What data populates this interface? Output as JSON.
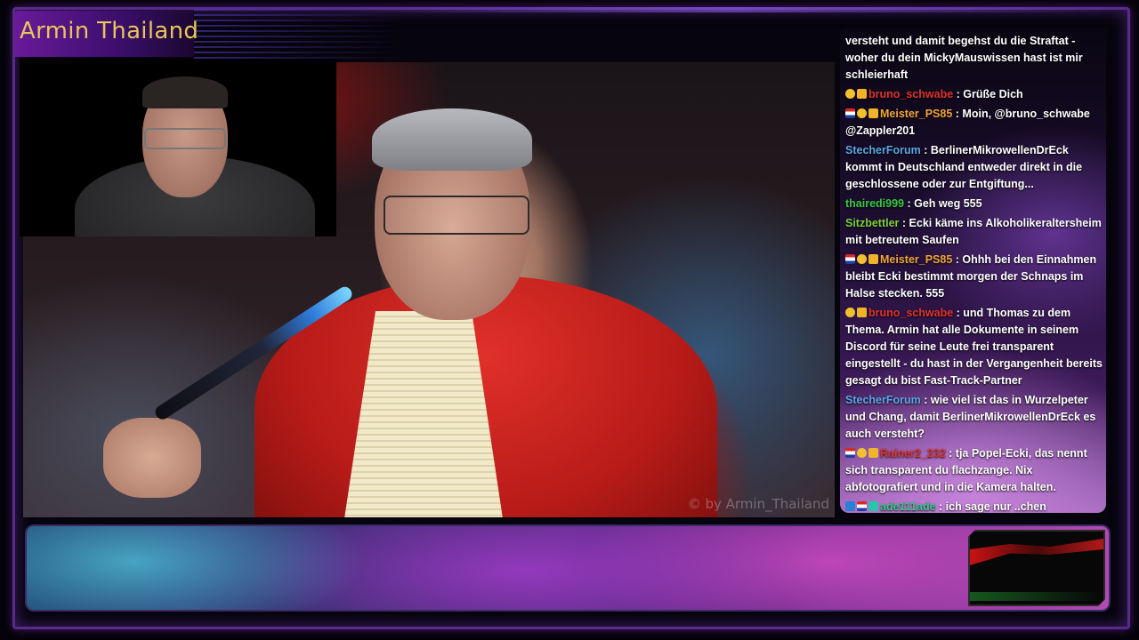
{
  "stream": {
    "channel_title": "Armin Thailand",
    "watermark": "© by Armin_Thailand"
  },
  "chat": {
    "messages": [
      {
        "user": "",
        "color": "#ffffff",
        "badges": [],
        "text": "versteht und damit begehst du die Straftat - woher du dein MickyMauswissen hast ist mir schleierhaft"
      },
      {
        "user": "bruno_schwabe",
        "color": "#e0332c",
        "badges": [
          "coin",
          "crown"
        ],
        "text": "Grüße Dich"
      },
      {
        "user": "Meister_PS85",
        "color": "#f0a43a",
        "badges": [
          "flag",
          "coin",
          "crown"
        ],
        "text": "Moin, @bruno_schwabe @Zappler201"
      },
      {
        "user": "StecherForum",
        "color": "#5aa7e6",
        "badges": [],
        "text": "BerlinerMikrowellenDrEck kommt in Deutschland entweder direkt in die geschlossene oder zur Entgiftung..."
      },
      {
        "user": "thairedi999",
        "color": "#37c944",
        "badges": [],
        "text": "Geh weg 555"
      },
      {
        "user": "Sitzbettler",
        "color": "#7bd23a",
        "badges": [],
        "text": "Ecki käme ins Alkoholikeraltersheim mit betreutem Saufen"
      },
      {
        "user": "Meister_PS85",
        "color": "#f0a43a",
        "badges": [
          "flag",
          "coin",
          "crown"
        ],
        "text": "Ohhh bei den Einnahmen bleibt Ecki bestimmt morgen der Schnaps im Halse stecken. 555"
      },
      {
        "user": "bruno_schwabe",
        "color": "#e0332c",
        "badges": [
          "coin",
          "crown"
        ],
        "text": "und Thomas zu dem Thema. Armin hat alle Dokumente in seinem Discord für seine Leute frei transparent eingestellt - du hast in der Vergangenheit bereits gesagt du bist Fast-Track-Partner"
      },
      {
        "user": "StecherForum",
        "color": "#5aa7e6",
        "badges": [],
        "text": "wie viel ist das in Wurzelpeter und Chang, damit BerlinerMikrowellenDrEck es auch versteht?"
      },
      {
        "user": "Rainer2_232",
        "color": "#e0332c",
        "badges": [
          "flag",
          "coin",
          "crown"
        ],
        "text": "tja Popel-Ecki, das nennt sich transparent du flachzange. Nix abfotografiert und in die Kamera halten."
      },
      {
        "user": "ade111ade",
        "color": "#37c98a",
        "badges": [
          "prime",
          "flag",
          "gift"
        ],
        "text": "ich sage nur ..chen"
      }
    ]
  },
  "colors": {
    "accent": "#5a2a8a",
    "title_text": "#e8c45a"
  },
  "icons": {
    "flag": "thailand-flag-badge-icon",
    "coin": "coin-badge-icon",
    "crown": "crown-badge-icon",
    "prime": "prime-badge-icon",
    "gift": "gift-badge-icon"
  }
}
